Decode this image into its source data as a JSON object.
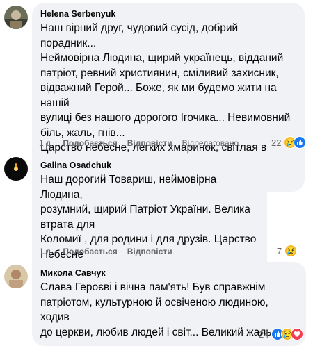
{
  "comments": [
    {
      "author": "Helena Serbenyuk",
      "text": "Наш вірний друг, чудовий сусід, добрий порадник...\nНеймовірна Людина, щирий українець, відданий\nпатріот, ревний християнин, сміливий захисник,\nвідважний Герой... Боже, як ми будемо жити на нашій\nвулиці без нашого дорогого Ігочика... Невимовний\nбіль, жаль, гнів...\nЦарство небесне, легких хмаринок, світлая в вічная\nпам'ять",
      "emojis": "🙏🕯️🕯️💙💛",
      "time": "1 д.",
      "like_label": "Подобається",
      "reply_label": "Відповісти",
      "edited_label": "Відредаговано",
      "reaction_count": "22"
    },
    {
      "author": "Galina Osadchuk",
      "text": "Наш дорогий Товариш, неймовірна Людина,\nрозумний, щирий Патріот України. Велика втрата для\nКоломиї , для родини і для друзів. Царство Небесне\nІгореві. Ти для нас назавжди залишишся вірним\nдругом.",
      "time": "1 д.",
      "like_label": "Подобається",
      "reply_label": "Відповісти",
      "reaction_count": "7"
    },
    {
      "author": "Микола Савчук",
      "text": "Слава Героєві і вічна пам'ять! Був справжнім\nпатріотом, культурною й освіченою людиною, ходив\nдо церкви, любив людей і світ... Великий жаль...",
      "reaction_count": "24"
    }
  ],
  "icons": {
    "like": "like-icon",
    "sad": "sad-icon",
    "love": "love-icon"
  },
  "colors": {
    "bubble": "#f0f2f5",
    "like_blue": "#1877f2",
    "meta_gray": "#65676b"
  }
}
